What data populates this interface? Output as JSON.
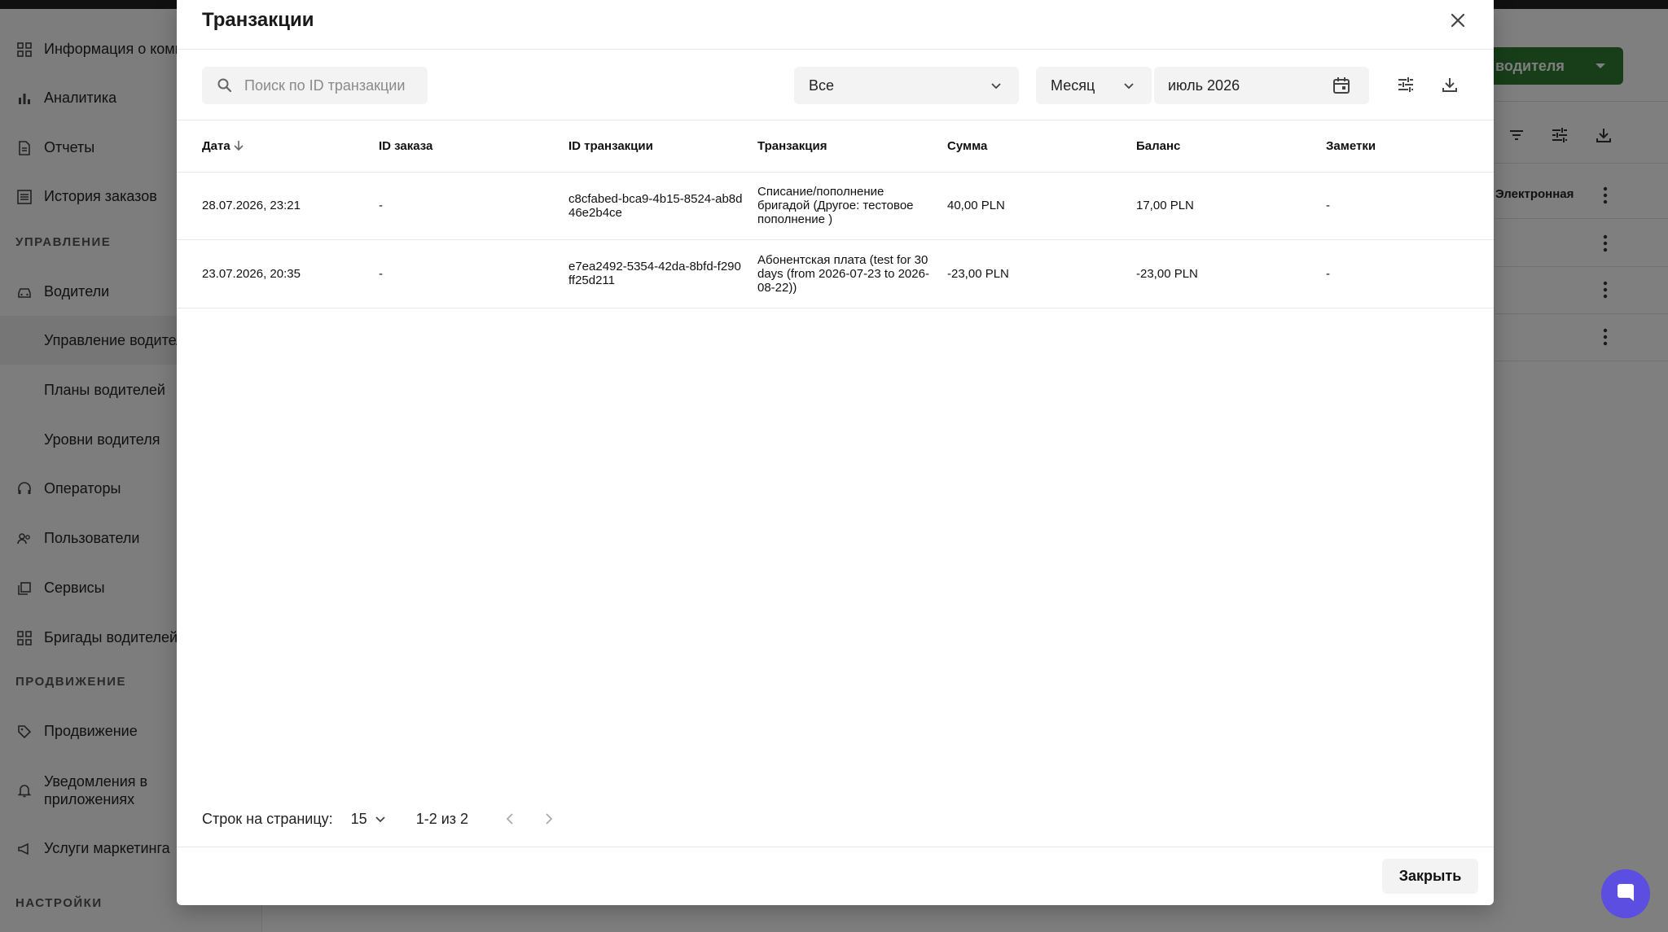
{
  "background": {
    "sidebar": {
      "items": [
        {
          "label": "Информация о компании",
          "icon": "dashboard-icon"
        },
        {
          "label": "Аналитика",
          "icon": "bar-chart-icon"
        },
        {
          "label": "Отчеты",
          "icon": "document-icon"
        },
        {
          "label": "История заказов",
          "icon": "list-icon"
        }
      ],
      "section_management": "УПРАВЛЕНИЕ",
      "management_items": [
        {
          "label": "Водители",
          "icon": "car-icon"
        },
        {
          "label": "Управление водителями",
          "icon": ""
        },
        {
          "label": "Планы водителей",
          "icon": ""
        },
        {
          "label": "Уровни водителя",
          "icon": ""
        },
        {
          "label": "Операторы",
          "icon": "headset-icon"
        },
        {
          "label": "Пользователи",
          "icon": "users-icon"
        },
        {
          "label": "Сервисы",
          "icon": "services-icon"
        },
        {
          "label": "Бригады водителей",
          "icon": "grid-icon"
        }
      ],
      "section_promotion": "ПРОДВИЖЕНИЕ",
      "promotion_items": [
        {
          "label": "Продвижение",
          "icon": "tag-icon"
        },
        {
          "label": "Уведомления в приложениях",
          "icon": "bell-icon"
        },
        {
          "label": "Услуги маркетинга",
          "icon": "megaphone-icon"
        }
      ],
      "section_settings": "НАСТРОЙКИ"
    },
    "add_driver_button": "водителя",
    "table_cell_partial": "Электронная по"
  },
  "modal": {
    "title": "Транзакции",
    "search_placeholder": "Поиск по ID транзакции",
    "type_filter": "Все",
    "period_filter": "Месяц",
    "date_value": "июль 2026",
    "columns": {
      "date": "Дата",
      "order_id": "ID заказа",
      "transaction_id": "ID транзакции",
      "transaction": "Транзакция",
      "amount": "Сумма",
      "balance": "Баланс",
      "notes": "Заметки"
    },
    "rows": [
      {
        "date": "28.07.2026, 23:21",
        "order_id": "-",
        "transaction_id": "c8cfabed-bca9-4b15-8524-ab8d46e2b4ce",
        "transaction": "Списание/пополнение бригадой (Другое: тестовое пополнение )",
        "amount": "40,00 PLN",
        "balance": "17,00 PLN",
        "notes": "-"
      },
      {
        "date": "23.07.2026, 20:35",
        "order_id": "-",
        "transaction_id": "e7ea2492-5354-42da-8bfd-f290ff25d211",
        "transaction": "Абонентская плата (test for 30 days (from 2026-07-23 to 2026-08-22))",
        "amount": "-23,00 PLN",
        "balance": "-23,00 PLN",
        "notes": "-"
      }
    ],
    "pagination": {
      "rows_per_page_label": "Строк на страницу:",
      "rows_per_page": "15",
      "range": "1-2 из 2"
    },
    "close_button": "Закрыть"
  },
  "colors": {
    "accent_green": "#2e7d32",
    "chat_purple": "#5b4ee0"
  }
}
